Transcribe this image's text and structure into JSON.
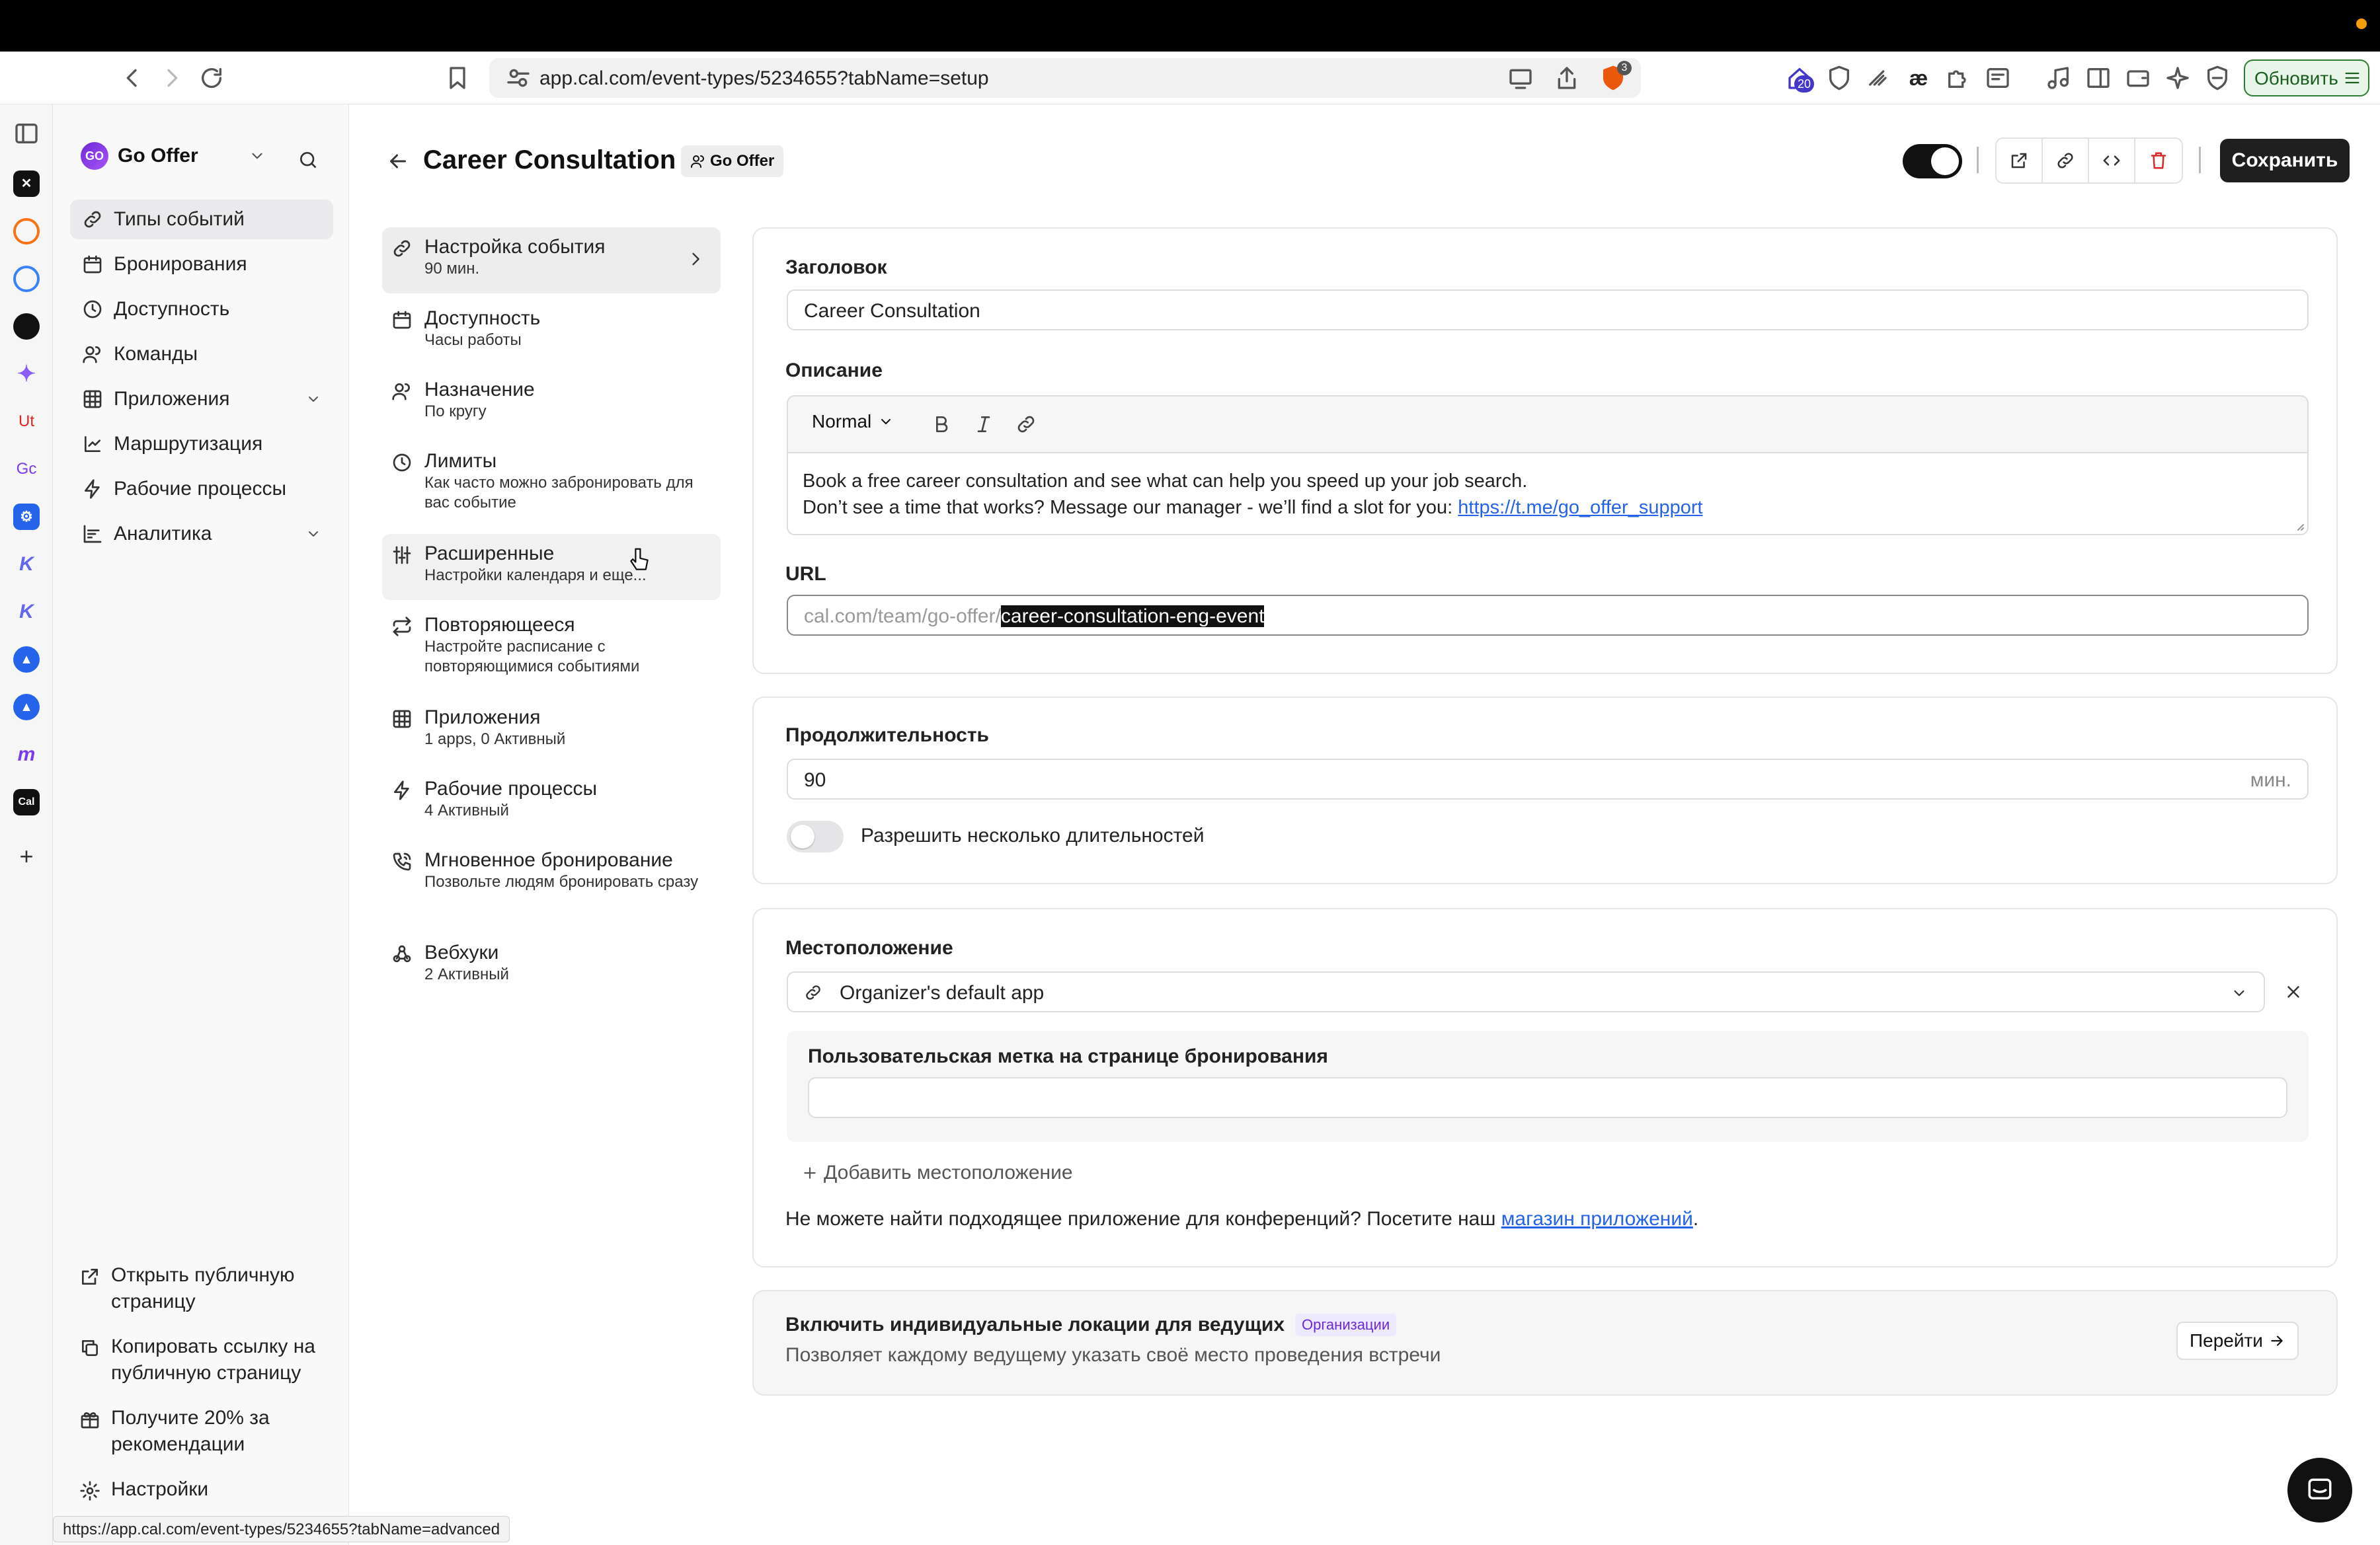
{
  "browser": {
    "url": "app.cal.com/event-types/5234655?tabName=setup",
    "update_button": "Обновить",
    "shield_badge": "3",
    "ext_badge": "20",
    "status_url": "https://app.cal.com/event-types/5234655?tabName=advanced"
  },
  "rail": {
    "ut_label": "Ut",
    "go_label": "Gc",
    "cal_label": "Cal"
  },
  "sidebar": {
    "org_name": "Go Offer",
    "org_logo": "GO",
    "items": [
      {
        "label": "Типы событий",
        "icon": "link-icon"
      },
      {
        "label": "Бронирования",
        "icon": "calendar-icon"
      },
      {
        "label": "Доступность",
        "icon": "clock-icon"
      },
      {
        "label": "Команды",
        "icon": "users-icon"
      },
      {
        "label": "Приложения",
        "icon": "grid-icon"
      },
      {
        "label": "Маршрутизация",
        "icon": "routing-icon"
      },
      {
        "label": "Рабочие процессы",
        "icon": "zap-icon"
      },
      {
        "label": "Аналитика",
        "icon": "chart-icon"
      }
    ],
    "bottom": {
      "public_page": "Открыть публичную страницу",
      "copy_link": "Копировать ссылку на публичную страницу",
      "referral": "Получите 20% за рекомендации",
      "settings": "Настройки"
    }
  },
  "header": {
    "title": "Career Consultation",
    "team_badge": "Go Offer",
    "save": "Сохранить"
  },
  "tabs": [
    {
      "title": "Настройка события",
      "sub": "90 мин."
    },
    {
      "title": "Доступность",
      "sub": "Часы работы"
    },
    {
      "title": "Назначение",
      "sub": "По кругу"
    },
    {
      "title": "Лимиты",
      "sub": "Как часто можно забронировать для вас событие"
    },
    {
      "title": "Расширенные",
      "sub": "Настройки календаря и еще..."
    },
    {
      "title": "Повторяющееся",
      "sub": "Настройте расписание с повторяющимися событиями"
    },
    {
      "title": "Приложения",
      "sub": "1 apps, 0 Активный"
    },
    {
      "title": "Рабочие процессы",
      "sub": "4 Активный"
    },
    {
      "title": "Мгновенное бронирование",
      "sub": "Позвольте людям бронировать сразу"
    },
    {
      "title": "Вебхуки",
      "sub": "2 Активный"
    }
  ],
  "form": {
    "title_label": "Заголовок",
    "title_value": "Career Consultation",
    "desc_label": "Описание",
    "format": "Normal",
    "desc_line1": "Book a free career consultation and see what can help you speed up your job search.",
    "desc_line2": "Don’t see a time that works? Message our manager - we’ll find a slot for you: ",
    "desc_link": "https://t.me/go_offer_support",
    "url_label": "URL",
    "url_prefix": "cal.com/team/go-offer/",
    "url_slug": "career-consultation-eng-event",
    "duration_label": "Продолжительность",
    "duration_value": "90",
    "duration_unit": "мин.",
    "multi_duration": "Разрешить несколько длительностей",
    "location_label": "Местоположение",
    "location_value": "Organizer's default app",
    "custom_label": "Пользовательская метка на странице бронирования",
    "custom_value": "",
    "add_location": "Добавить местоположение",
    "no_app_text": "Не можете найти подходящее приложение для конференций? Посетите наш ",
    "app_store_link": "магазин приложений",
    "period": "."
  },
  "promo": {
    "title": "Включить индивидуальные локации для ведущих",
    "badge": "Организации",
    "desc": "Позволяет каждому ведущему указать своё место проведения встречи",
    "button": "Перейти"
  },
  "colors": {
    "accent": "#111111",
    "link": "#2563eb",
    "badge_purple": "#7c3aed",
    "danger": "#dc2626"
  }
}
